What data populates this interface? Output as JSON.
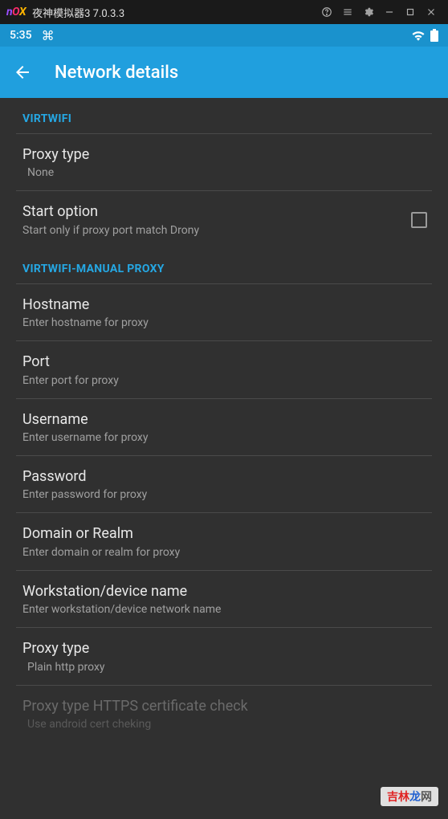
{
  "emulator": {
    "logo": {
      "n": "n",
      "o": "O",
      "x": "X"
    },
    "title": "夜神模拟器3 7.0.3.3"
  },
  "status": {
    "time": "5:35",
    "cmd": "⌘"
  },
  "appbar": {
    "title": "Network details"
  },
  "sections": {
    "virtwifi": {
      "header": "VIRTWIFI"
    },
    "manual": {
      "header": "VIRTWIFI-MANUAL PROXY"
    }
  },
  "items": {
    "proxy_type": {
      "title": "Proxy type",
      "subtitle": "None"
    },
    "start_option": {
      "title": "Start option",
      "subtitle": "Start only if proxy port match Drony"
    },
    "hostname": {
      "title": "Hostname",
      "subtitle": "Enter hostname for proxy"
    },
    "port": {
      "title": "Port",
      "subtitle": "Enter port for proxy"
    },
    "username": {
      "title": "Username",
      "subtitle": "Enter username for proxy"
    },
    "password": {
      "title": "Password",
      "subtitle": "Enter password for proxy"
    },
    "domain": {
      "title": "Domain or Realm",
      "subtitle": "Enter domain or realm for proxy"
    },
    "workstation": {
      "title": "Workstation/device name",
      "subtitle": "Enter workstation/device network name"
    },
    "proxy_type2": {
      "title": "Proxy type",
      "subtitle": "Plain http proxy"
    },
    "https_check": {
      "title": "Proxy type HTTPS certificate check",
      "subtitle": "Use android cert cheking"
    }
  },
  "watermark": {
    "a": "吉林",
    "b": "龙",
    "c": "网"
  }
}
